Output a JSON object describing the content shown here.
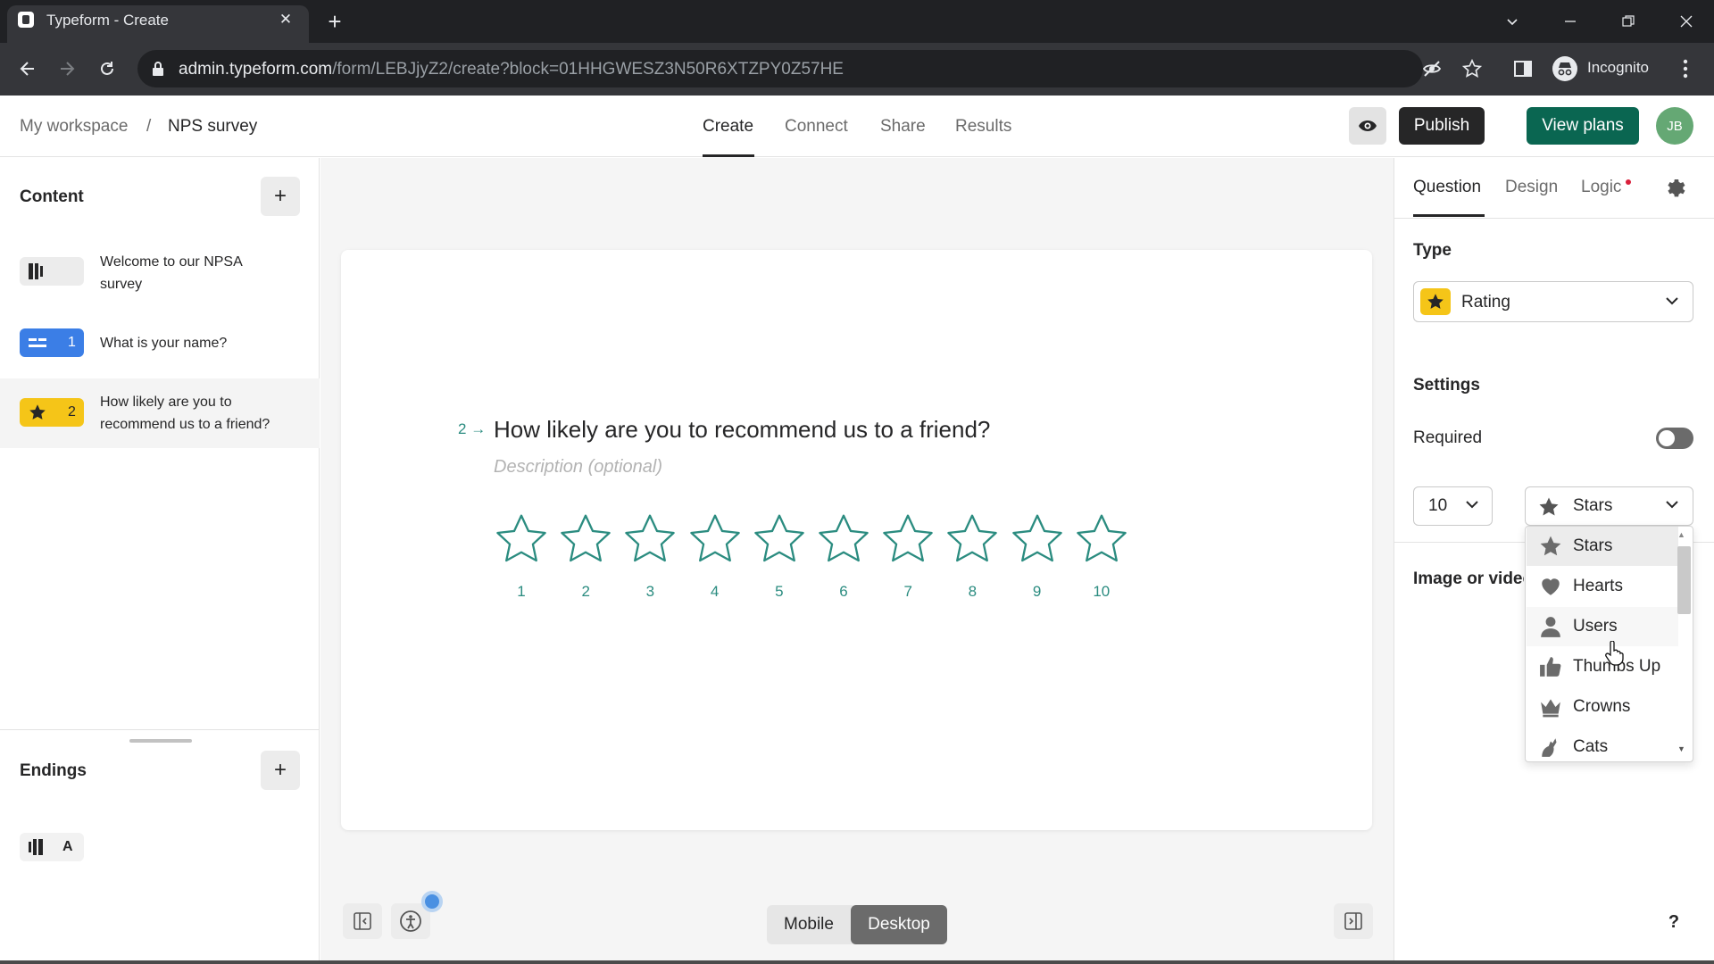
{
  "browser": {
    "tab_title": "Typeform - Create",
    "url_host": "admin.typeform.com",
    "url_path": "/form/LEBJjyZ2/create?block=01HHGWESZ3N50R6XTZPY0Z57HE",
    "profile_label": "Incognito"
  },
  "header": {
    "breadcrumb_workspace": "My workspace",
    "breadcrumb_sep": "/",
    "breadcrumb_form": "NPS survey",
    "tabs": [
      "Create",
      "Connect",
      "Share",
      "Results"
    ],
    "publish_label": "Publish",
    "plans_label": "View plans",
    "avatar_initials": "JB"
  },
  "left_panel": {
    "content_label": "Content",
    "items": [
      {
        "badge_num": "",
        "text": "Welcome to our NPSA survey",
        "icon": "welcome-screen-icon"
      },
      {
        "badge_num": "1",
        "text": "What is your name?",
        "icon": "short-text-icon"
      },
      {
        "badge_num": "2",
        "text": "How likely are you to recommend us to a friend?",
        "icon": "star-icon"
      }
    ],
    "endings_label": "Endings",
    "ending_items": [
      {
        "badge_letter": "A",
        "icon": "ending-screen-icon"
      }
    ]
  },
  "canvas": {
    "question_number": "2",
    "question_title": "How likely are you to recommend us to a friend?",
    "description_placeholder": "Description (optional)",
    "rating_labels": [
      "1",
      "2",
      "3",
      "4",
      "5",
      "6",
      "7",
      "8",
      "9",
      "10"
    ],
    "star_color": "#2b8c80",
    "mode_mobile": "Mobile",
    "mode_desktop": "Desktop"
  },
  "right_panel": {
    "tabs": [
      "Question",
      "Design",
      "Logic"
    ],
    "type_label": "Type",
    "type_value": "Rating",
    "settings_label": "Settings",
    "required_label": "Required",
    "required_on": false,
    "steps_value": "10",
    "shape_value": "Stars",
    "media_label": "Image or video",
    "shape_options": [
      {
        "label": "Stars",
        "icon": "star-icon"
      },
      {
        "label": "Hearts",
        "icon": "heart-icon"
      },
      {
        "label": "Users",
        "icon": "user-icon"
      },
      {
        "label": "Thumbs Up",
        "icon": "thumbs-up-icon"
      },
      {
        "label": "Crowns",
        "icon": "crown-icon"
      },
      {
        "label": "Cats",
        "icon": "cat-icon"
      }
    ],
    "help_label": "?"
  }
}
